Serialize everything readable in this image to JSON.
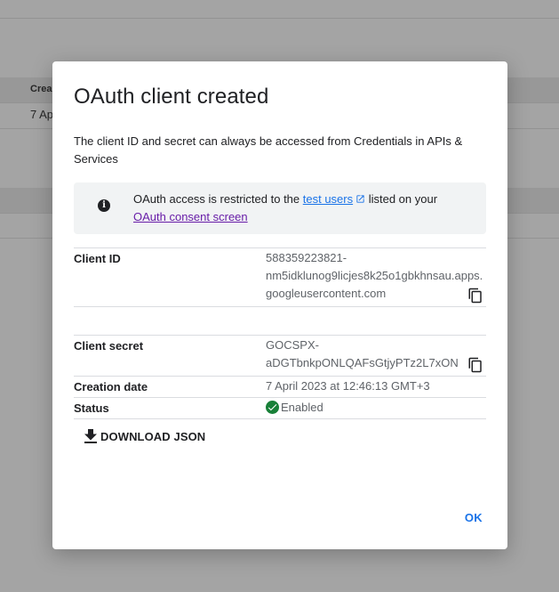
{
  "background": {
    "table_header": "Crea",
    "table_cell": "7 Ap"
  },
  "dialog": {
    "title": "OAuth client created",
    "description": "The client ID and secret can always be accessed from Credentials in APIs & Services",
    "notice": {
      "icon": "info-icon",
      "prefix": "OAuth access is restricted to the ",
      "test_users_link": "test users",
      "middle": " listed on your",
      "consent_link": "OAuth consent screen"
    },
    "client_id": {
      "label": "Client ID",
      "line1": "588359223821-",
      "line2": "nm5idklunog9licjes8k25o1gbkhnsau.apps.",
      "line3": "googleusercontent.com",
      "copy_icon": "copy-icon"
    },
    "client_secret": {
      "label": "Client secret",
      "line1": "GOCSPX-",
      "line2": "aDGTbnkpONLQAFsGtjyPTz2L7xON",
      "copy_icon": "copy-icon"
    },
    "creation_date": {
      "label": "Creation date",
      "value": "7 April 2023 at 12:46:13 GMT+3"
    },
    "status": {
      "label": "Status",
      "value": "Enabled",
      "color": "#188038"
    },
    "download_label": "DOWNLOAD JSON",
    "ok_label": "OK"
  },
  "colors": {
    "accent": "#1a73e8",
    "visited_link": "#681da8",
    "scrim": "#a4a4a4"
  }
}
